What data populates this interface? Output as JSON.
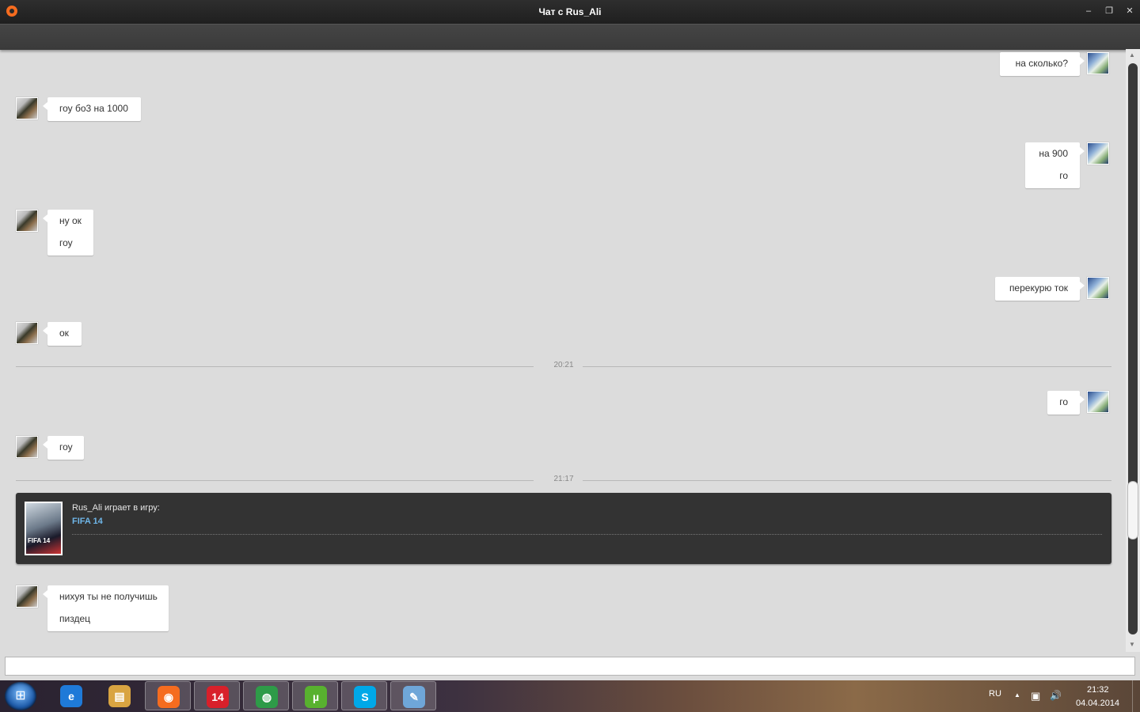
{
  "window": {
    "title": "Чат с Rus_Ali",
    "minimize": "‒",
    "restore": "❐",
    "close": "✕"
  },
  "messages": [
    {
      "side": "right",
      "lines": [
        "на сколько?"
      ]
    },
    {
      "side": "left",
      "lines": [
        "гоу бо3 на 1000"
      ]
    },
    {
      "side": "right",
      "lines": [
        "на 900",
        "го"
      ]
    },
    {
      "side": "left",
      "lines": [
        "ну ок",
        "гоу"
      ]
    },
    {
      "side": "right",
      "lines": [
        "перекурю ток"
      ]
    },
    {
      "side": "left",
      "lines": [
        "ок"
      ]
    },
    {
      "side": "right",
      "lines": [
        "го"
      ]
    },
    {
      "side": "left",
      "lines": [
        "гоу"
      ]
    },
    {
      "side": "left",
      "lines": [
        "нихуя ты не получишь",
        "пиздец"
      ]
    }
  ],
  "separators": [
    "20:21",
    "21:17"
  ],
  "game_activity": {
    "text": "Rus_Ali играет в игру:",
    "game": "FIFA 14",
    "cover_label": "FIFA 14"
  },
  "input": {
    "value": "",
    "placeholder": ""
  },
  "taskbar": {
    "start_icon": "windows-start-icon",
    "apps": [
      {
        "name": "internet-explorer-icon",
        "glyph": "e",
        "color": "#1f7ad8"
      },
      {
        "name": "file-explorer-icon",
        "glyph": "▤",
        "color": "#d9a441"
      },
      {
        "name": "origin-icon",
        "glyph": "◉",
        "color": "#f56c1f",
        "active": true
      },
      {
        "name": "fifa14-icon",
        "glyph": "14",
        "color": "#d8202a"
      },
      {
        "name": "chrome-icon",
        "glyph": "◍",
        "color": "#2e9b48"
      },
      {
        "name": "utorrent-icon",
        "glyph": "µ",
        "color": "#58b12f"
      },
      {
        "name": "skype-icon",
        "glyph": "S",
        "color": "#00a8e8"
      },
      {
        "name": "paint-icon",
        "glyph": "✎",
        "color": "#6fa6d8"
      }
    ],
    "language": "RU",
    "tray_arrow": "▲",
    "network_glyph": "▣",
    "volume_glyph": "🔊",
    "time": "21:32",
    "date": "04.04.2014"
  }
}
